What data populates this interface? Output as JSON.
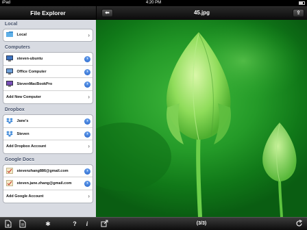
{
  "statusbar": {
    "carrier": "iPad",
    "time": "4:20 PM"
  },
  "sidebar": {
    "title": "File Explorer",
    "sections": [
      {
        "title": "Local",
        "rows": [
          {
            "label": "Local",
            "icon": "folder-icon",
            "accessory": "chevron"
          }
        ]
      },
      {
        "title": "Computers",
        "rows": [
          {
            "label": "steven-ubuntu",
            "icon": "monitor-icon",
            "accessory": "disclosure"
          },
          {
            "label": "Office Computer",
            "icon": "monitor-icon",
            "accessory": "disclosure"
          },
          {
            "label": "StevenMacBookPro",
            "icon": "monitor-icon",
            "accessory": "disclosure"
          },
          {
            "label": "Add New Computer",
            "icon": "",
            "accessory": "chevron"
          }
        ]
      },
      {
        "title": "Dropbox",
        "rows": [
          {
            "label": "Jane's",
            "icon": "dropbox-icon",
            "accessory": "disclosure"
          },
          {
            "label": "Steven",
            "icon": "dropbox-icon",
            "accessory": "disclosure"
          },
          {
            "label": "Add Dropbox Account",
            "icon": "",
            "accessory": "chevron"
          }
        ]
      },
      {
        "title": "Google Docs",
        "rows": [
          {
            "label": "stevenzhang886@gmail.com",
            "icon": "google-docs-icon",
            "accessory": "disclosure"
          },
          {
            "label": "steven.jane.zhang@gmail.com",
            "icon": "google-docs-icon",
            "accessory": "disclosure"
          },
          {
            "label": "Add Google Account",
            "icon": "",
            "accessory": "chevron"
          }
        ]
      }
    ],
    "footer_icons": [
      "new-file-icon",
      "document-icon",
      "gear-icon",
      "help-icon",
      "info-icon"
    ]
  },
  "viewer": {
    "title": "45.jpg",
    "page_indicator": "(3/3)",
    "footer_icons": [
      "fullscreen-icon",
      "rotate-icon"
    ],
    "header_icons": [
      "back-arrow-icon",
      "share-icon"
    ]
  },
  "colors": {
    "accent_blue": "#2b6bd6",
    "photo_green": "#2aa52b",
    "toolbar_black": "#111111"
  }
}
